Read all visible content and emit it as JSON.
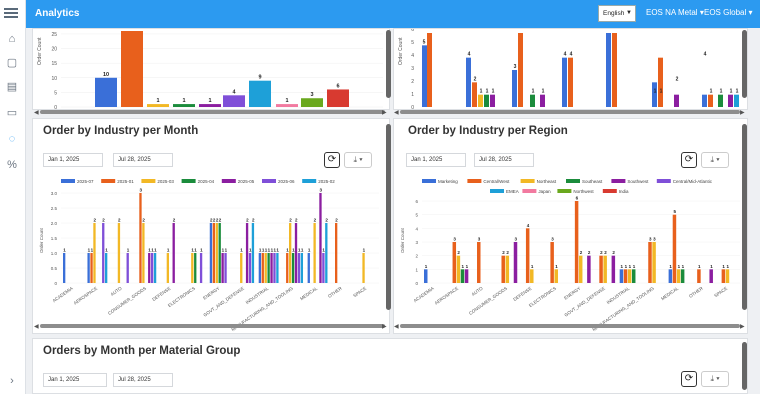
{
  "header": {
    "title": "Analytics",
    "language": "English",
    "site": "EOS NA Metal",
    "org": "EOS Global"
  },
  "sidebar": {
    "items": [
      "home-icon",
      "document-icon",
      "table-icon",
      "monitor-icon",
      "lightbulb-icon",
      "percent-icon",
      "expand-icon"
    ]
  },
  "top_left_chart": {
    "ylabel": "Order Count",
    "ticks": [
      "25",
      "20",
      "15",
      "10",
      "5",
      "0"
    ],
    "chart_data": {
      "type": "bar",
      "values": [
        10,
        28,
        1,
        1,
        1,
        4,
        9,
        1,
        3,
        6
      ],
      "labels": [
        "10",
        "",
        "1",
        "1",
        "1",
        "4",
        "9",
        "1",
        "3",
        "6"
      ],
      "colors": [
        "#3a6fd8",
        "#e8601c",
        "#f2b825",
        "#1b8c3c",
        "#8b1ea0",
        "#7f4fd8",
        "#1ea0d8",
        "#f27aa0",
        "#6aa81e",
        "#d83a30"
      ]
    }
  },
  "top_right_chart": {
    "ylabel": "Order Count",
    "ticks": [
      "6",
      "5",
      "4",
      "3",
      "2",
      "1",
      "0"
    ],
    "bar_labels": [
      "5",
      "4",
      "2",
      "1",
      "1",
      "1",
      "3",
      "1",
      "1",
      "4",
      "4",
      "1",
      "1",
      "2",
      "4",
      "1",
      "1",
      "1",
      "1",
      "1",
      "1"
    ]
  },
  "industry_month": {
    "title": "Order by Industry per Month",
    "date_from": "Jan 1, 2025",
    "date_to": "Jul 28, 2025",
    "refresh": "⟳",
    "download": "⤓ ▾",
    "legend": [
      {
        "label": "2025-07",
        "color": "#3a6fd8"
      },
      {
        "label": "2025-01",
        "color": "#e8601c"
      },
      {
        "label": "2025-03",
        "color": "#f2b825"
      },
      {
        "label": "2025-04",
        "color": "#1b8c3c"
      },
      {
        "label": "2025-05",
        "color": "#8b1ea0"
      },
      {
        "label": "2025-06",
        "color": "#7f4fd8"
      },
      {
        "label": "2025-02",
        "color": "#1ea0d8"
      }
    ],
    "ylabel": "Order Count",
    "yticks": [
      "3.0",
      "2.5",
      "2.0",
      "1.5",
      "1.0",
      "0.5",
      "0"
    ],
    "categories": [
      "ACADEMIA",
      "AEROSPACE",
      "AUTO",
      "CONSUMER_GOODS",
      "DEFENSE",
      "ELECTRONICS",
      "ENERGY",
      "GOVT_AND_DEFENSE",
      "INDUSTRIAL",
      "MANUFACTURING_AND_TOOLING",
      "MEDICAL",
      "OTHER",
      "SPACE"
    ],
    "chart_data": {
      "type": "bar",
      "series_colors": [
        "#3a6fd8",
        "#e8601c",
        "#f2b825",
        "#1b8c3c",
        "#8b1ea0",
        "#7f4fd8",
        "#1ea0d8"
      ],
      "groups": [
        [
          1,
          0,
          0,
          0,
          0,
          0,
          0
        ],
        [
          1,
          1,
          2,
          0,
          0,
          2,
          1
        ],
        [
          0,
          0,
          2,
          0,
          0,
          1,
          0
        ],
        [
          0,
          3,
          2,
          0,
          1,
          1,
          1
        ],
        [
          0,
          0,
          1,
          0,
          2,
          0,
          0
        ],
        [
          0,
          0,
          1,
          1,
          0,
          1,
          0
        ],
        [
          2,
          2,
          2,
          2,
          1,
          1,
          0
        ],
        [
          0,
          0,
          1,
          0,
          2,
          1,
          2
        ],
        [
          1,
          1,
          1,
          1,
          1,
          1,
          1
        ],
        [
          0,
          1,
          2,
          1,
          2,
          1,
          1
        ],
        [
          1,
          0,
          2,
          0,
          3,
          1,
          2
        ],
        [
          0,
          2,
          0,
          0,
          0,
          0,
          0
        ],
        [
          0,
          0,
          1,
          0,
          0,
          0,
          0
        ]
      ]
    }
  },
  "industry_region": {
    "title": "Order by Industry per Region",
    "date_from": "Jan 1, 2025",
    "date_to": "Jul 28, 2025",
    "refresh": "⟳",
    "download": "⤓ ▾",
    "legend": [
      {
        "label": "Marketing",
        "color": "#3a6fd8"
      },
      {
        "label": "Central/West",
        "color": "#e8601c"
      },
      {
        "label": "Northeast",
        "color": "#f2b825"
      },
      {
        "label": "Southeast",
        "color": "#1b8c3c"
      },
      {
        "label": "Southwest",
        "color": "#8b1ea0"
      },
      {
        "label": "Central/Mid-Atlantic",
        "color": "#7f4fd8"
      },
      {
        "label": "EMEA",
        "color": "#1ea0d8"
      },
      {
        "label": "Japan",
        "color": "#f27aa0"
      },
      {
        "label": "Northwest",
        "color": "#6aa81e"
      },
      {
        "label": "India",
        "color": "#d83a30"
      }
    ],
    "ylabel": "Order Count",
    "yticks": [
      "6",
      "5",
      "4",
      "3",
      "2",
      "1",
      "0"
    ],
    "categories": [
      "ACADEMIA",
      "AEROSPACE",
      "AUTO",
      "CONSUMER_GOODS",
      "DEFENSE",
      "ELECTRONICS",
      "ENERGY",
      "GOVT_AND_DEFENSE",
      "INDUSTRIAL",
      "MANUFACTURING_AND_TOOLING",
      "MEDICAL",
      "OTHER",
      "SPACE"
    ],
    "chart_data": {
      "type": "bar",
      "series_colors": [
        "#3a6fd8",
        "#e8601c",
        "#f2b825",
        "#1b8c3c",
        "#8b1ea0"
      ],
      "groups": [
        [
          1,
          0,
          0,
          0,
          0
        ],
        [
          0,
          3,
          2,
          1,
          1
        ],
        [
          0,
          3,
          0,
          0,
          0
        ],
        [
          0,
          2,
          2,
          0,
          3
        ],
        [
          0,
          4,
          1,
          0,
          0
        ],
        [
          0,
          3,
          1,
          0,
          0
        ],
        [
          0,
          6,
          2,
          0,
          2
        ],
        [
          0,
          2,
          2,
          0,
          2
        ],
        [
          1,
          1,
          1,
          1,
          0
        ],
        [
          0,
          3,
          3,
          0,
          0
        ],
        [
          1,
          5,
          1,
          1,
          0
        ],
        [
          0,
          1,
          0,
          0,
          1
        ],
        [
          0,
          1,
          1,
          0,
          0
        ]
      ]
    }
  },
  "material_group": {
    "title": "Orders by Month per Material Group",
    "date_from": "Jan 1, 2025",
    "date_to": "Jul 28, 2025",
    "refresh": "⟳",
    "download": "⤓ ▾"
  }
}
